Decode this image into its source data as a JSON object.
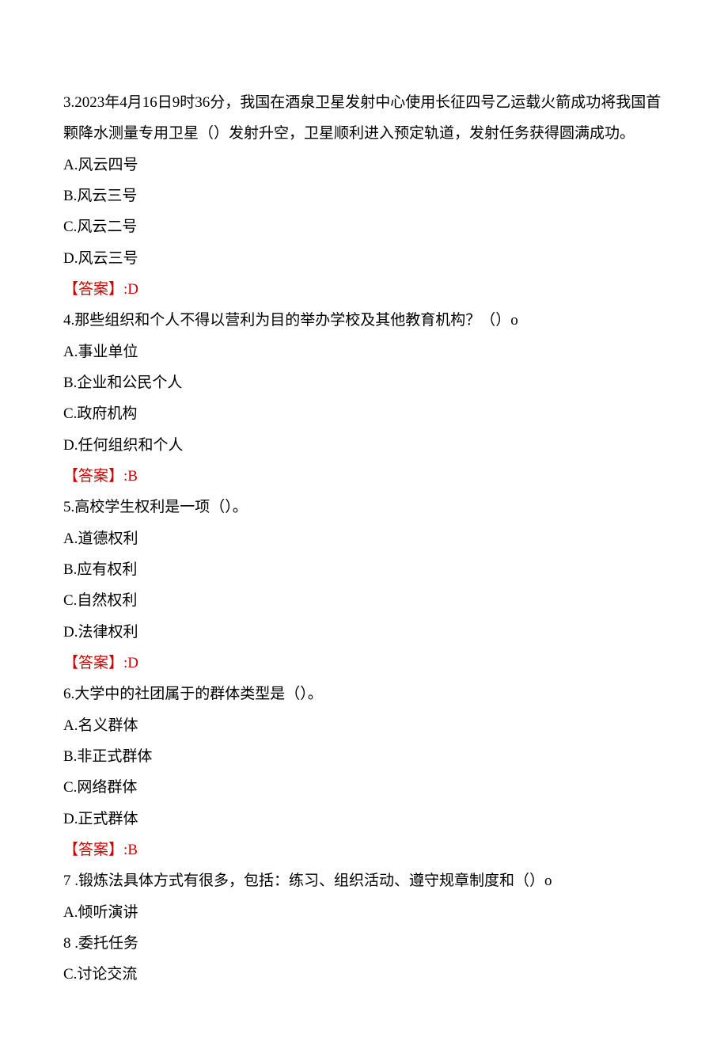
{
  "questions": [
    {
      "num": "3.",
      "stem": "2023年4月16日9时36分，我国在酒泉卫星发射中心使用长征四号乙运载火箭成功将我国首颗降水测量专用卫星（）发射升空，卫星顺利进入预定轨道，发射任务获得圆满成功。",
      "options": [
        "A.风云四号",
        "B.风云三号",
        "C.风云二号",
        "D.风云三号"
      ],
      "answer_label": "【答案】:",
      "answer_value": "D"
    },
    {
      "num": "4.",
      "stem": "那些组织和个人不得以营利为目的举办学校及其他教育机构？（）o",
      "options": [
        "A.事业单位",
        "B.企业和公民个人",
        "C.政府机构",
        "D.任何组织和个人"
      ],
      "answer_label": "【答案】:",
      "answer_value": "B"
    },
    {
      "num": "5.",
      "stem": "高校学生权利是一项（）。",
      "options": [
        "A.道德权利",
        "B.应有权利",
        "C.自然权利",
        "D.法律权利"
      ],
      "answer_label": "【答案】",
      "answer_value": ":D"
    },
    {
      "num": "6.",
      "stem": "大学中的社团属于的群体类型是（）。",
      "options": [
        "A.名义群体",
        "B.非正式群体",
        "C.网络群体",
        "D.正式群体"
      ],
      "answer_label": "【答案】:",
      "answer_value": "B"
    },
    {
      "num": "7 .",
      "stem": "锻炼法具体方式有很多，包括：练习、组织活动、遵守规章制度和（）o",
      "options": [
        "A.倾听演讲",
        "8 .委托任务",
        "C.讨论交流"
      ],
      "answer_label": "",
      "answer_value": ""
    }
  ]
}
